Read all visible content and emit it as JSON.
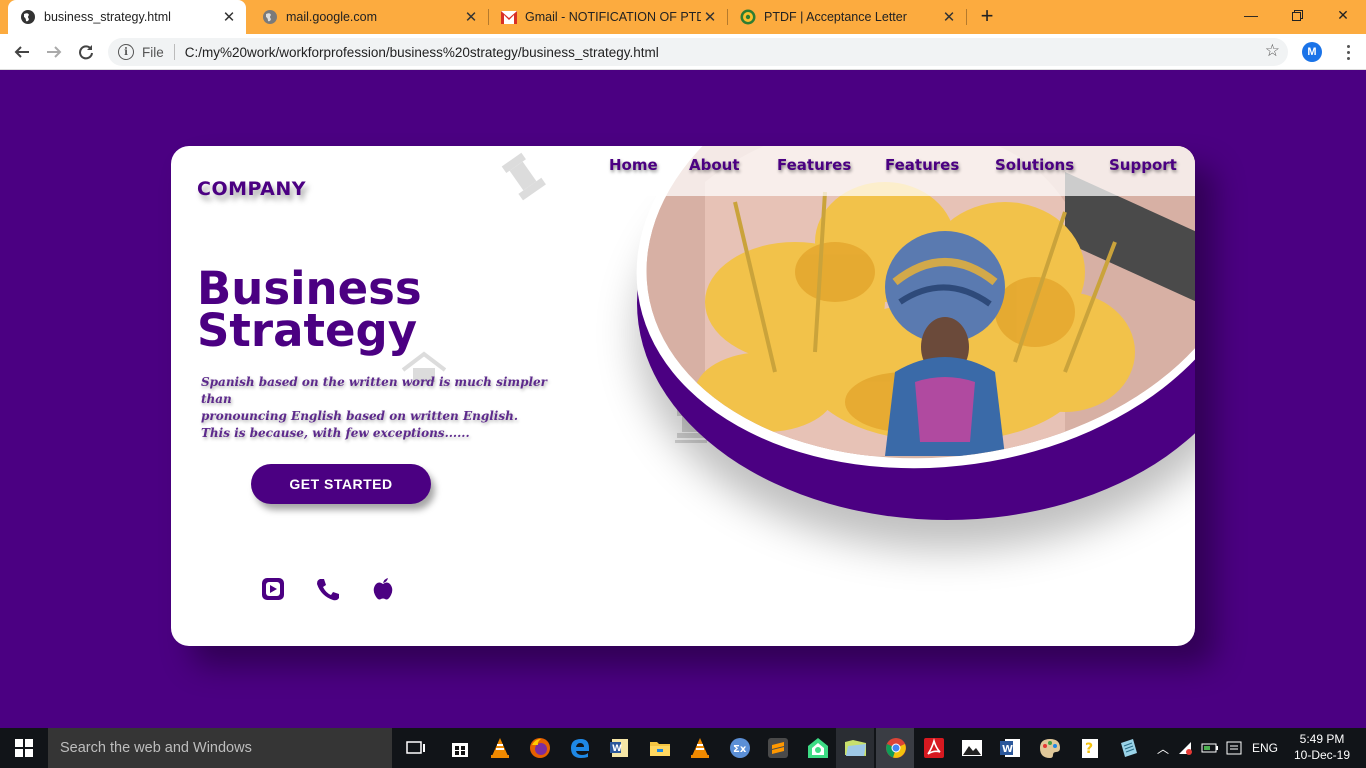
{
  "browser": {
    "tabs": [
      {
        "title": "business_strategy.html",
        "favicon": "globe-icon",
        "active": true
      },
      {
        "title": "mail.google.com",
        "favicon": "globe-icon",
        "active": false
      },
      {
        "title": "Gmail - NOTIFICATION OF PTDF",
        "favicon": "gmail-icon",
        "active": false
      },
      {
        "title": "PTDF | Acceptance Letter",
        "favicon": "ptdf-icon",
        "active": false
      }
    ],
    "new_tab_label": "+",
    "address": {
      "scheme_label": "File",
      "url": "C:/my%20work/workforprofession/business%20strategy/business_strategy.html"
    },
    "profile_initial": "M",
    "chrome_color": "#fcab3f"
  },
  "page": {
    "background": "#4b0082",
    "logo": "COMPANY",
    "nav": [
      "Home",
      "About",
      "Features",
      "Features",
      "Solutions",
      "Support"
    ],
    "headline_line1": "Business",
    "headline_line2": "Strategy",
    "blurb": "Spanish based on the written word is much simpler than\npronouncing English based on written English.\nThis is because, with few exceptions......",
    "cta_label": "GET STARTED",
    "social_icons": [
      "video-play-icon",
      "phone-icon",
      "apple-icon"
    ]
  },
  "taskbar": {
    "search_placeholder": "Search the web and Windows",
    "pinned": [
      "task-view-icon",
      "store-icon",
      "vlc-icon",
      "firefox-icon",
      "edge-icon",
      "word-doc-icon",
      "file-explorer-icon",
      "vlc-icon",
      "math-app-icon",
      "sublime-text-icon",
      "android-studio-icon",
      "folder-icon",
      "chrome-icon",
      "acrobat-icon",
      "photos-icon",
      "word-icon",
      "paint-icon",
      "help-icon",
      "notepad-icon"
    ],
    "language": "ENG",
    "time": "5:49 PM",
    "date": "10-Dec-19"
  }
}
